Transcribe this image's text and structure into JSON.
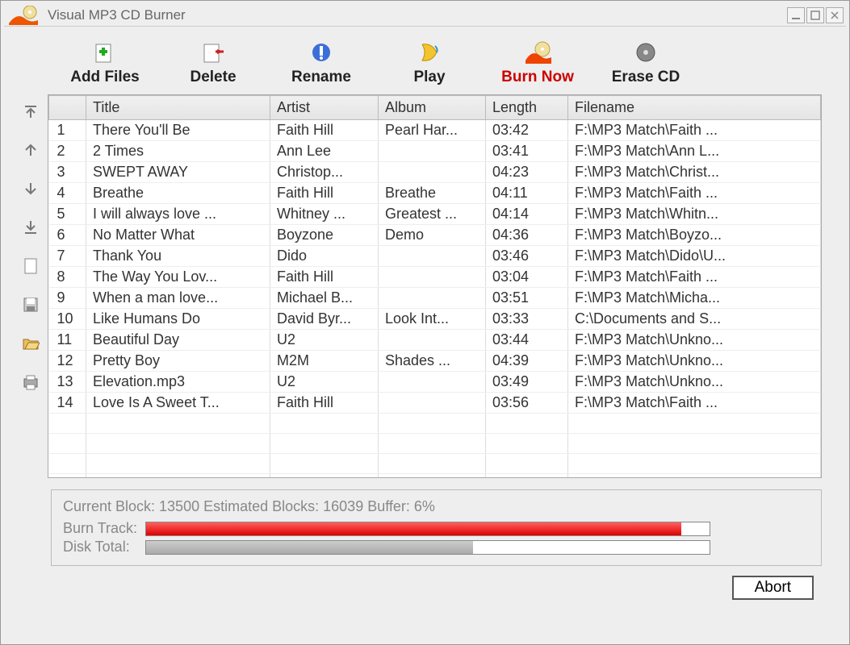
{
  "window": {
    "title": "Visual MP3 CD Burner"
  },
  "toolbar": [
    {
      "label": "Add Files",
      "icon": "add-files-icon",
      "red": false
    },
    {
      "label": "Delete",
      "icon": "delete-icon",
      "red": false
    },
    {
      "label": "Rename",
      "icon": "rename-icon",
      "red": false
    },
    {
      "label": "Play",
      "icon": "play-icon",
      "red": false
    },
    {
      "label": "Burn Now",
      "icon": "burn-now-icon",
      "red": true
    },
    {
      "label": "Erase CD",
      "icon": "erase-cd-icon",
      "red": false
    }
  ],
  "sidebar_icons": [
    "move-top-icon",
    "move-up-icon",
    "move-down-icon",
    "move-bottom-icon",
    "new-list-icon",
    "save-list-icon",
    "open-list-icon",
    "print-icon"
  ],
  "columns": [
    "",
    "Title",
    "Artist",
    "Album",
    "Length",
    "Filename"
  ],
  "tracks": [
    {
      "n": "1",
      "title": "There You'll Be",
      "artist": "Faith Hill",
      "album": "Pearl Har...",
      "len": "03:42",
      "file": "F:\\MP3 Match\\Faith ..."
    },
    {
      "n": "2",
      "title": "2 Times",
      "artist": "Ann Lee",
      "album": "",
      "len": "03:41",
      "file": "F:\\MP3 Match\\Ann L..."
    },
    {
      "n": "3",
      "title": "SWEPT AWAY",
      "artist": "Christop...",
      "album": "",
      "len": "04:23",
      "file": "F:\\MP3 Match\\Christ..."
    },
    {
      "n": "4",
      "title": "Breathe",
      "artist": "Faith Hill",
      "album": "Breathe",
      "len": "04:11",
      "file": "F:\\MP3 Match\\Faith ..."
    },
    {
      "n": "5",
      "title": "I will always love ...",
      "artist": "Whitney ...",
      "album": "Greatest ...",
      "len": "04:14",
      "file": "F:\\MP3 Match\\Whitn..."
    },
    {
      "n": "6",
      "title": "No Matter What",
      "artist": "Boyzone",
      "album": "Demo",
      "len": "04:36",
      "file": "F:\\MP3 Match\\Boyzo..."
    },
    {
      "n": "7",
      "title": "Thank You",
      "artist": "Dido",
      "album": "",
      "len": "03:46",
      "file": "F:\\MP3 Match\\Dido\\U..."
    },
    {
      "n": "8",
      "title": "The Way You Lov...",
      "artist": "Faith Hill",
      "album": "",
      "len": "03:04",
      "file": "F:\\MP3 Match\\Faith ..."
    },
    {
      "n": "9",
      "title": "When a man love...",
      "artist": "Michael B...",
      "album": "",
      "len": "03:51",
      "file": "F:\\MP3 Match\\Micha..."
    },
    {
      "n": "10",
      "title": "Like Humans Do",
      "artist": "David Byr...",
      "album": "Look Int...",
      "len": "03:33",
      "file": "C:\\Documents and S..."
    },
    {
      "n": "11",
      "title": "Beautiful Day",
      "artist": "U2",
      "album": "",
      "len": "03:44",
      "file": "F:\\MP3 Match\\Unkno..."
    },
    {
      "n": "12",
      "title": "Pretty Boy",
      "artist": "M2M",
      "album": "Shades ...",
      "len": "04:39",
      "file": "F:\\MP3 Match\\Unkno..."
    },
    {
      "n": "13",
      "title": "Elevation.mp3",
      "artist": "U2",
      "album": "",
      "len": "03:49",
      "file": "F:\\MP3 Match\\Unkno..."
    },
    {
      "n": "14",
      "title": "Love Is A Sweet T...",
      "artist": "Faith Hill",
      "album": "",
      "len": "03:56",
      "file": "F:\\MP3 Match\\Faith ..."
    }
  ],
  "status": {
    "line1": "Current Block: 13500   Estimated Blocks: 16039   Buffer: 6%",
    "burn_label": "Burn Track:",
    "disk_label": "Disk Total:",
    "burn_pct": 95,
    "disk_pct": 58
  },
  "buttons": {
    "abort": "Abort"
  }
}
